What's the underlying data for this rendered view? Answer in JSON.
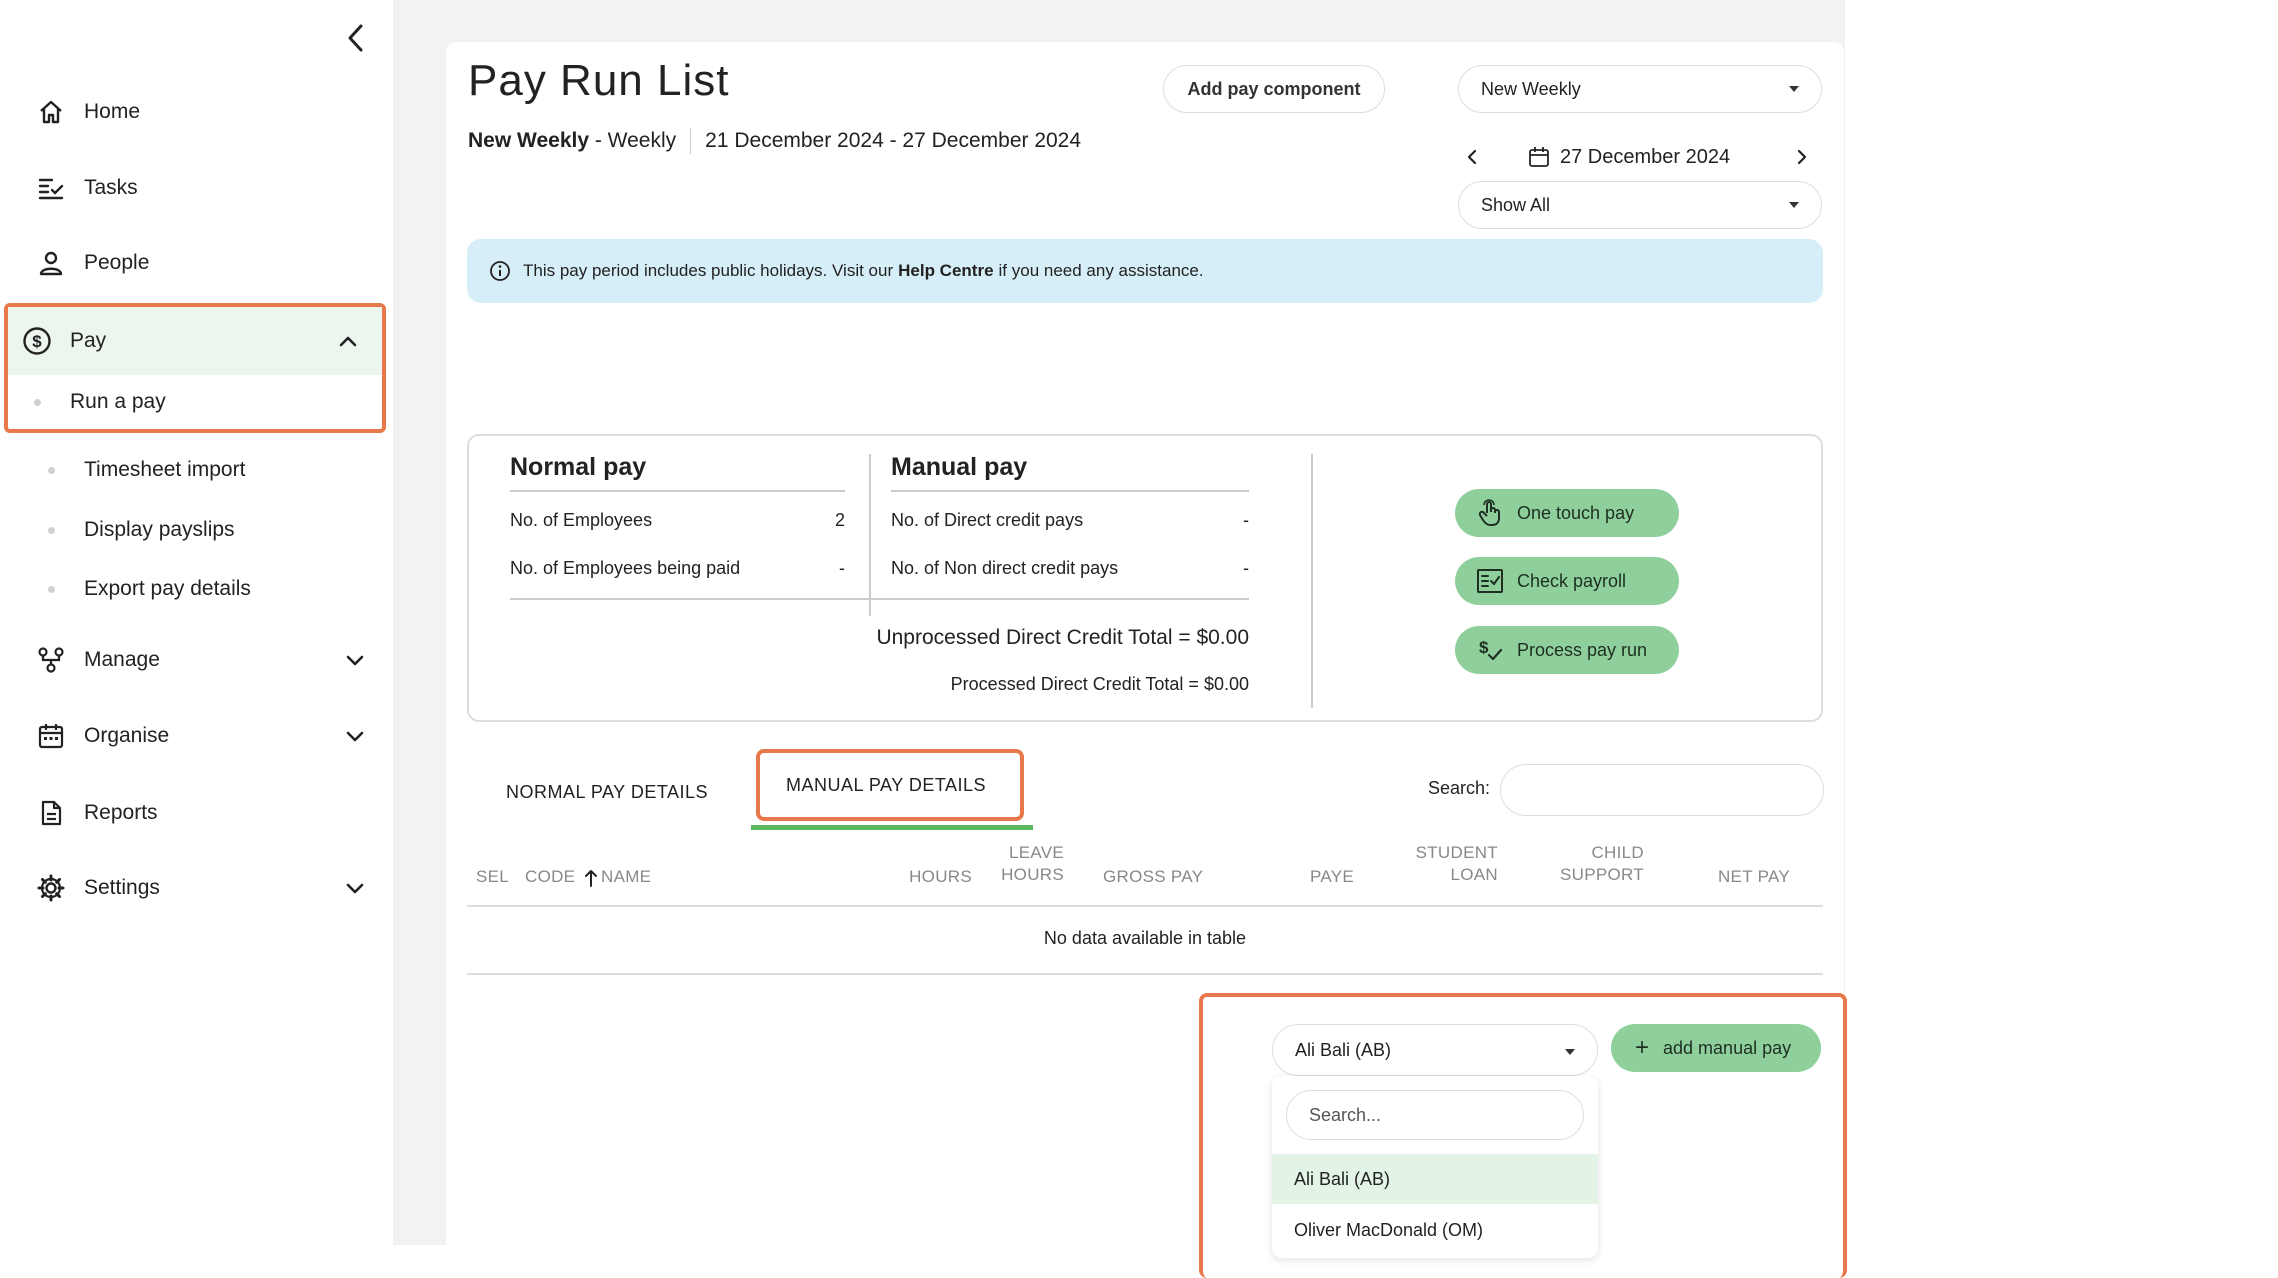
{
  "sidebar": {
    "items": [
      {
        "label": "Home",
        "icon": "home-icon"
      },
      {
        "label": "Tasks",
        "icon": "tasks-icon"
      },
      {
        "label": "People",
        "icon": "person-icon"
      },
      {
        "label": "Pay",
        "icon": "dollar-circle-icon"
      },
      {
        "label": "Manage",
        "icon": "org-chart-icon"
      },
      {
        "label": "Organise",
        "icon": "calendar-icon"
      },
      {
        "label": "Reports",
        "icon": "document-icon"
      },
      {
        "label": "Settings",
        "icon": "gear-icon"
      }
    ],
    "pay_sub": [
      "Run a pay",
      "Timesheet import",
      "Display payslips",
      "Export pay details"
    ]
  },
  "header": {
    "title": "Pay Run List",
    "schedule_name": "New Weekly",
    "frequency": "- Weekly",
    "period": "21 December 2024 - 27 December 2024",
    "add_component": "Add pay component",
    "schedule_select": "New Weekly",
    "date": "27 December 2024",
    "filter_select": "Show All"
  },
  "alert": {
    "before": "This pay period includes public holidays. Visit our",
    "link": "Help Centre",
    "after": "if you need any assistance."
  },
  "summary": {
    "normal_title": "Normal pay",
    "manual_title": "Manual pay",
    "normal_rows": [
      {
        "label": "No. of Employees",
        "value": "2"
      },
      {
        "label": "No. of Employees being paid",
        "value": "-"
      }
    ],
    "manual_rows": [
      {
        "label": "No. of Direct credit pays",
        "value": "-"
      },
      {
        "label": "No. of Non direct credit pays",
        "value": "-"
      }
    ],
    "unprocessed_total": "Unprocessed Direct Credit Total  =  $0.00",
    "processed_total": "Processed Direct Credit Total  =  $0.00"
  },
  "actions": {
    "one_touch": "One touch pay",
    "check_payroll": "Check payroll",
    "process": "Process pay run"
  },
  "tabs": {
    "normal": "NORMAL PAY DETAILS",
    "manual": "MANUAL PAY DETAILS"
  },
  "search": {
    "label": "Search:",
    "value": ""
  },
  "table": {
    "headers": {
      "sel": "SEL",
      "code": "CODE",
      "name": "NAME",
      "hours": "HOURS",
      "leave_1": "LEAVE",
      "leave_2": "HOURS",
      "gross": "GROSS PAY",
      "paye": "PAYE",
      "student_1": "STUDENT",
      "student_2": "LOAN",
      "child_1": "CHILD",
      "child_2": "SUPPORT",
      "net": "NET PAY"
    },
    "empty": "No data available in table"
  },
  "manual_pay": {
    "selected": "Ali Bali (AB)",
    "add_label": "add manual pay",
    "search_placeholder": "Search...",
    "options": [
      "Ali Bali (AB)",
      "Oliver MacDonald (OM)"
    ]
  },
  "colors": {
    "accent_green": "#8fcf9c",
    "highlight_orange": "#e8774a",
    "alert_blue": "#d6eef8",
    "tab_underline": "#5cb85c"
  }
}
